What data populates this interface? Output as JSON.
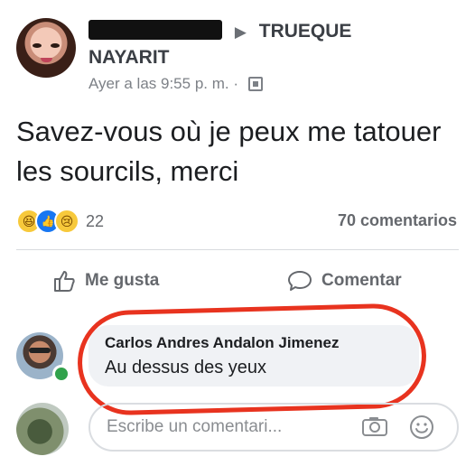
{
  "post": {
    "author_name": "",
    "group_name": "TRUEQUE",
    "group_name_2": "NAYARIT",
    "timestamp": "Ayer a las 9:55 p. m.",
    "separator": "·",
    "text": "Savez-vous où je peux me tatouer les sourcils, merci",
    "reaction_count": "22",
    "comments_count": "70 comentarios"
  },
  "actions": {
    "like_label": "Me gusta",
    "comment_label": "Comentar"
  },
  "comment": {
    "author": "Carlos Andres Andalon Jimenez",
    "text": "Au dessus des yeux"
  },
  "composer": {
    "placeholder": "Escribe un comentari..."
  },
  "icons": {
    "privacy": "group-privacy-icon",
    "like": "thumbs-up-icon",
    "comment": "speech-bubble-icon",
    "camera": "camera-icon",
    "emoji": "smiley-icon"
  },
  "colors": {
    "highlight": "#e8331f",
    "online": "#31a24c",
    "link_blue": "#1877f2"
  }
}
